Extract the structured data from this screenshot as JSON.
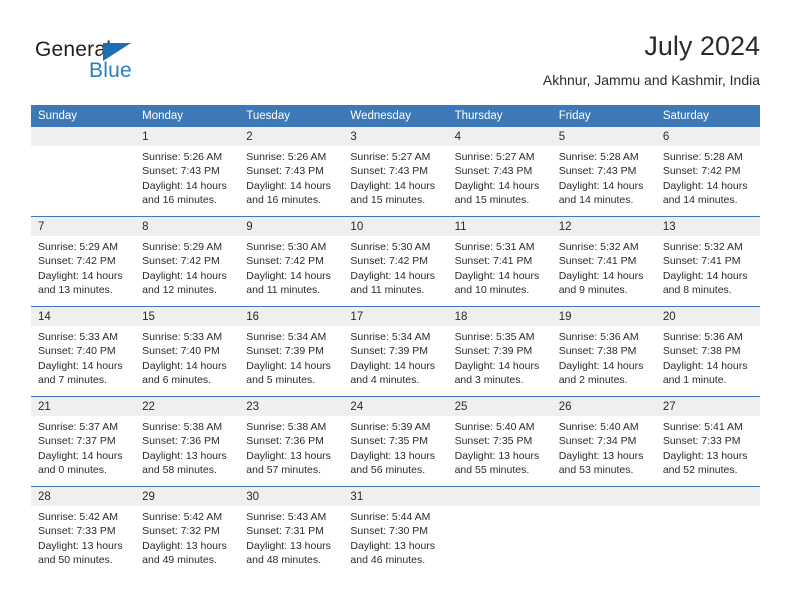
{
  "brand": {
    "word_one": "General",
    "word_two": "Blue",
    "triangle_color": "#1a6fb5",
    "word_two_color": "#2580c3"
  },
  "header": {
    "title": "July 2024",
    "subtitle": "Akhnur, Jammu and Kashmir, India"
  },
  "theme": {
    "header_blue": "#3d79b7",
    "daynum_band": "#efefef",
    "text": "#2b2b2b"
  },
  "weekday_headers": [
    "Sunday",
    "Monday",
    "Tuesday",
    "Wednesday",
    "Thursday",
    "Friday",
    "Saturday"
  ],
  "weeks": [
    [
      {
        "day": "",
        "sunrise": "",
        "sunset": "",
        "daylight_line1": "",
        "daylight_line2": ""
      },
      {
        "day": "1",
        "sunrise": "Sunrise: 5:26 AM",
        "sunset": "Sunset: 7:43 PM",
        "daylight_line1": "Daylight: 14 hours",
        "daylight_line2": "and 16 minutes."
      },
      {
        "day": "2",
        "sunrise": "Sunrise: 5:26 AM",
        "sunset": "Sunset: 7:43 PM",
        "daylight_line1": "Daylight: 14 hours",
        "daylight_line2": "and 16 minutes."
      },
      {
        "day": "3",
        "sunrise": "Sunrise: 5:27 AM",
        "sunset": "Sunset: 7:43 PM",
        "daylight_line1": "Daylight: 14 hours",
        "daylight_line2": "and 15 minutes."
      },
      {
        "day": "4",
        "sunrise": "Sunrise: 5:27 AM",
        "sunset": "Sunset: 7:43 PM",
        "daylight_line1": "Daylight: 14 hours",
        "daylight_line2": "and 15 minutes."
      },
      {
        "day": "5",
        "sunrise": "Sunrise: 5:28 AM",
        "sunset": "Sunset: 7:43 PM",
        "daylight_line1": "Daylight: 14 hours",
        "daylight_line2": "and 14 minutes."
      },
      {
        "day": "6",
        "sunrise": "Sunrise: 5:28 AM",
        "sunset": "Sunset: 7:42 PM",
        "daylight_line1": "Daylight: 14 hours",
        "daylight_line2": "and 14 minutes."
      }
    ],
    [
      {
        "day": "7",
        "sunrise": "Sunrise: 5:29 AM",
        "sunset": "Sunset: 7:42 PM",
        "daylight_line1": "Daylight: 14 hours",
        "daylight_line2": "and 13 minutes."
      },
      {
        "day": "8",
        "sunrise": "Sunrise: 5:29 AM",
        "sunset": "Sunset: 7:42 PM",
        "daylight_line1": "Daylight: 14 hours",
        "daylight_line2": "and 12 minutes."
      },
      {
        "day": "9",
        "sunrise": "Sunrise: 5:30 AM",
        "sunset": "Sunset: 7:42 PM",
        "daylight_line1": "Daylight: 14 hours",
        "daylight_line2": "and 11 minutes."
      },
      {
        "day": "10",
        "sunrise": "Sunrise: 5:30 AM",
        "sunset": "Sunset: 7:42 PM",
        "daylight_line1": "Daylight: 14 hours",
        "daylight_line2": "and 11 minutes."
      },
      {
        "day": "11",
        "sunrise": "Sunrise: 5:31 AM",
        "sunset": "Sunset: 7:41 PM",
        "daylight_line1": "Daylight: 14 hours",
        "daylight_line2": "and 10 minutes."
      },
      {
        "day": "12",
        "sunrise": "Sunrise: 5:32 AM",
        "sunset": "Sunset: 7:41 PM",
        "daylight_line1": "Daylight: 14 hours",
        "daylight_line2": "and 9 minutes."
      },
      {
        "day": "13",
        "sunrise": "Sunrise: 5:32 AM",
        "sunset": "Sunset: 7:41 PM",
        "daylight_line1": "Daylight: 14 hours",
        "daylight_line2": "and 8 minutes."
      }
    ],
    [
      {
        "day": "14",
        "sunrise": "Sunrise: 5:33 AM",
        "sunset": "Sunset: 7:40 PM",
        "daylight_line1": "Daylight: 14 hours",
        "daylight_line2": "and 7 minutes."
      },
      {
        "day": "15",
        "sunrise": "Sunrise: 5:33 AM",
        "sunset": "Sunset: 7:40 PM",
        "daylight_line1": "Daylight: 14 hours",
        "daylight_line2": "and 6 minutes."
      },
      {
        "day": "16",
        "sunrise": "Sunrise: 5:34 AM",
        "sunset": "Sunset: 7:39 PM",
        "daylight_line1": "Daylight: 14 hours",
        "daylight_line2": "and 5 minutes."
      },
      {
        "day": "17",
        "sunrise": "Sunrise: 5:34 AM",
        "sunset": "Sunset: 7:39 PM",
        "daylight_line1": "Daylight: 14 hours",
        "daylight_line2": "and 4 minutes."
      },
      {
        "day": "18",
        "sunrise": "Sunrise: 5:35 AM",
        "sunset": "Sunset: 7:39 PM",
        "daylight_line1": "Daylight: 14 hours",
        "daylight_line2": "and 3 minutes."
      },
      {
        "day": "19",
        "sunrise": "Sunrise: 5:36 AM",
        "sunset": "Sunset: 7:38 PM",
        "daylight_line1": "Daylight: 14 hours",
        "daylight_line2": "and 2 minutes."
      },
      {
        "day": "20",
        "sunrise": "Sunrise: 5:36 AM",
        "sunset": "Sunset: 7:38 PM",
        "daylight_line1": "Daylight: 14 hours",
        "daylight_line2": "and 1 minute."
      }
    ],
    [
      {
        "day": "21",
        "sunrise": "Sunrise: 5:37 AM",
        "sunset": "Sunset: 7:37 PM",
        "daylight_line1": "Daylight: 14 hours",
        "daylight_line2": "and 0 minutes."
      },
      {
        "day": "22",
        "sunrise": "Sunrise: 5:38 AM",
        "sunset": "Sunset: 7:36 PM",
        "daylight_line1": "Daylight: 13 hours",
        "daylight_line2": "and 58 minutes."
      },
      {
        "day": "23",
        "sunrise": "Sunrise: 5:38 AM",
        "sunset": "Sunset: 7:36 PM",
        "daylight_line1": "Daylight: 13 hours",
        "daylight_line2": "and 57 minutes."
      },
      {
        "day": "24",
        "sunrise": "Sunrise: 5:39 AM",
        "sunset": "Sunset: 7:35 PM",
        "daylight_line1": "Daylight: 13 hours",
        "daylight_line2": "and 56 minutes."
      },
      {
        "day": "25",
        "sunrise": "Sunrise: 5:40 AM",
        "sunset": "Sunset: 7:35 PM",
        "daylight_line1": "Daylight: 13 hours",
        "daylight_line2": "and 55 minutes."
      },
      {
        "day": "26",
        "sunrise": "Sunrise: 5:40 AM",
        "sunset": "Sunset: 7:34 PM",
        "daylight_line1": "Daylight: 13 hours",
        "daylight_line2": "and 53 minutes."
      },
      {
        "day": "27",
        "sunrise": "Sunrise: 5:41 AM",
        "sunset": "Sunset: 7:33 PM",
        "daylight_line1": "Daylight: 13 hours",
        "daylight_line2": "and 52 minutes."
      }
    ],
    [
      {
        "day": "28",
        "sunrise": "Sunrise: 5:42 AM",
        "sunset": "Sunset: 7:33 PM",
        "daylight_line1": "Daylight: 13 hours",
        "daylight_line2": "and 50 minutes."
      },
      {
        "day": "29",
        "sunrise": "Sunrise: 5:42 AM",
        "sunset": "Sunset: 7:32 PM",
        "daylight_line1": "Daylight: 13 hours",
        "daylight_line2": "and 49 minutes."
      },
      {
        "day": "30",
        "sunrise": "Sunrise: 5:43 AM",
        "sunset": "Sunset: 7:31 PM",
        "daylight_line1": "Daylight: 13 hours",
        "daylight_line2": "and 48 minutes."
      },
      {
        "day": "31",
        "sunrise": "Sunrise: 5:44 AM",
        "sunset": "Sunset: 7:30 PM",
        "daylight_line1": "Daylight: 13 hours",
        "daylight_line2": "and 46 minutes."
      },
      {
        "day": "",
        "sunrise": "",
        "sunset": "",
        "daylight_line1": "",
        "daylight_line2": ""
      },
      {
        "day": "",
        "sunrise": "",
        "sunset": "",
        "daylight_line1": "",
        "daylight_line2": ""
      },
      {
        "day": "",
        "sunrise": "",
        "sunset": "",
        "daylight_line1": "",
        "daylight_line2": ""
      }
    ]
  ]
}
